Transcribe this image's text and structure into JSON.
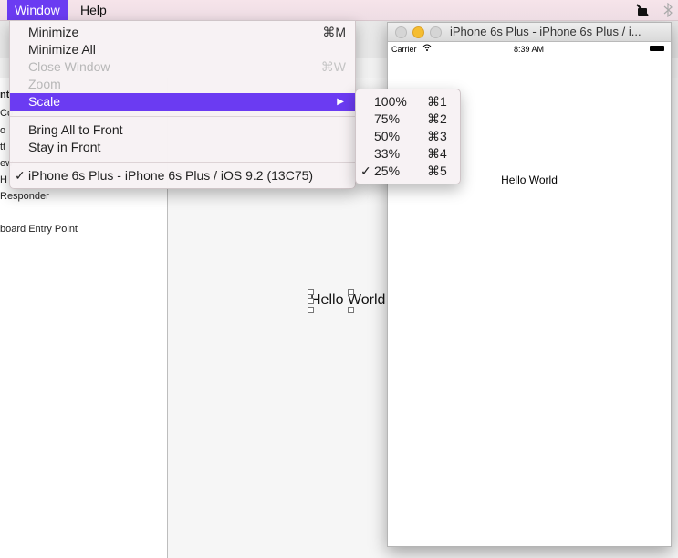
{
  "menubar": {
    "items": [
      "Window",
      "Help"
    ],
    "status_icons": [
      "sleep-icon",
      "bluetooth-icon"
    ]
  },
  "window_menu": {
    "items": [
      {
        "label": "Minimize",
        "shortcut": "⌘M"
      },
      {
        "label": "Minimize All",
        "shortcut": ""
      },
      {
        "label": "Close Window",
        "shortcut": "⌘W"
      },
      {
        "label": "Zoom",
        "shortcut": ""
      },
      {
        "label": "Scale",
        "shortcut": "▶"
      },
      {
        "label": "Bring All to Front",
        "shortcut": ""
      },
      {
        "label": "Stay in Front",
        "shortcut": ""
      },
      {
        "label": "iPhone 6s Plus - iPhone 6s Plus / iOS 9.2 (13C75)",
        "checked": "✓"
      }
    ]
  },
  "scale_menu": {
    "items": [
      {
        "label": "100%",
        "shortcut": "⌘1"
      },
      {
        "label": "75%",
        "shortcut": "⌘2"
      },
      {
        "label": "50%",
        "shortcut": "⌘3"
      },
      {
        "label": "33%",
        "shortcut": "⌘4"
      },
      {
        "label": "25%",
        "shortcut": "⌘5",
        "checked": "✓"
      }
    ]
  },
  "simulator": {
    "title": "iPhone 6s Plus - iPhone 6s Plus / i...",
    "carrier": "Carrier",
    "time": "8:39 AM",
    "label": "Hello World"
  },
  "xcode": {
    "outline_rows": [
      "nt",
      "Co",
      "o",
      "tt",
      "ew",
      "H",
      "Responder",
      "board Entry Point"
    ],
    "canvas_label": "Hello World"
  }
}
